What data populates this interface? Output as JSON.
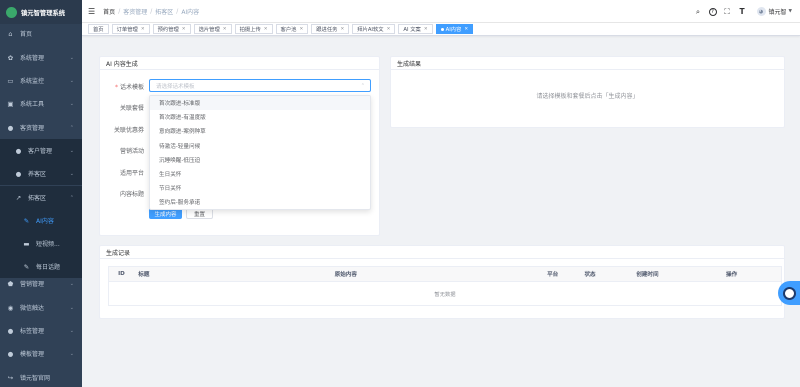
{
  "app": {
    "title": "镇元智管理系统"
  },
  "sidebar": {
    "items": [
      {
        "label": "首页",
        "icon": "home-icon",
        "glyph": "⌂"
      },
      {
        "label": "系统管理",
        "icon": "gear-icon",
        "glyph": "✿"
      },
      {
        "label": "系统监控",
        "icon": "monitor-icon",
        "glyph": "▭"
      },
      {
        "label": "系统工具",
        "icon": "tool-icon",
        "glyph": "▣"
      },
      {
        "label": "客资管理",
        "icon": "user-icon",
        "glyph": "●"
      },
      {
        "label": "客户管理",
        "icon": "users-icon",
        "glyph": "●"
      },
      {
        "label": "养客区",
        "icon": "users-icon",
        "glyph": "●"
      },
      {
        "label": "拓客区",
        "icon": "trend-icon",
        "glyph": "↗"
      },
      {
        "label": "AI内容",
        "icon": "edit-icon",
        "glyph": "✎"
      },
      {
        "label": "短视频...",
        "icon": "video-icon",
        "glyph": "▬"
      },
      {
        "label": "每日话题",
        "icon": "edit-icon",
        "glyph": "✎"
      },
      {
        "label": "营销管理",
        "icon": "shirt-icon",
        "glyph": "⬟"
      },
      {
        "label": "微信触达",
        "icon": "wechat-icon",
        "glyph": "◉"
      },
      {
        "label": "标签管理",
        "icon": "user-icon",
        "glyph": "●"
      },
      {
        "label": "模板管理",
        "icon": "user-icon",
        "glyph": "●"
      },
      {
        "label": "镇元智官网",
        "icon": "link-icon",
        "glyph": "↪"
      }
    ]
  },
  "navbar": {
    "breadcrumbs": [
      "首页",
      "客资管理",
      "拓客区",
      "AI内容"
    ],
    "user": "镇元智",
    "tools": [
      {
        "icon": "search-icon",
        "glyph": "⌕"
      },
      {
        "icon": "help-icon",
        "glyph": "?"
      },
      {
        "icon": "fullscreen-icon",
        "glyph": "⛶"
      },
      {
        "icon": "font-size-icon",
        "glyph": "T"
      }
    ]
  },
  "tags": [
    "首页",
    "订单管理",
    "预约管理",
    "选片管理",
    "拍摄上传",
    "客户池",
    "跟进任务",
    "拜片AI软文",
    "AI 文案",
    "AI内容"
  ],
  "form": {
    "title": "AI 内容生成",
    "labels": {
      "template": "话术模板",
      "package": "关联套餐",
      "coupon": "关联优惠券",
      "activity": "营销活动",
      "platform": "适用平台",
      "content_title": "内容标题"
    },
    "template_placeholder": "请选择话术模板",
    "options": [
      "首次跟进-标准版",
      "首次跟进-有温度版",
      "意向跟进-案例种草",
      "待激活-轻量问候",
      "沉睡唤醒-低压迫",
      "生日关怀",
      "节日关怀",
      "签约后-服务承诺"
    ],
    "generate_button": "生成内容",
    "reset_button": "重置"
  },
  "result": {
    "title": "生成结果",
    "empty_text": "请选择模板和套餐后点击「生成内容」"
  },
  "records": {
    "title": "生成记录",
    "columns": [
      "ID",
      "标题",
      "原始内容",
      "平台",
      "状态",
      "创建时间",
      "操作"
    ],
    "empty_text": "暂无数据"
  },
  "colors": {
    "sidebar": "#304156",
    "accent": "#409eff",
    "required": "#f56c6c"
  }
}
